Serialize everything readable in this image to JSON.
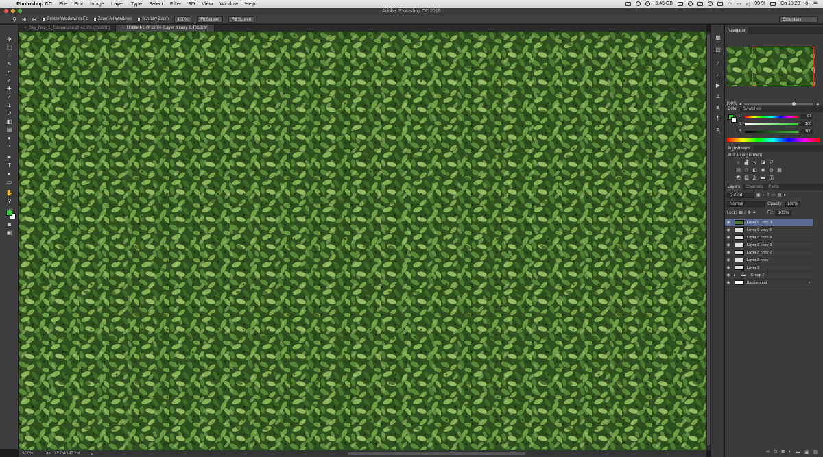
{
  "menubar": {
    "app_name": "Photoshop CC",
    "items": [
      "File",
      "Edit",
      "Image",
      "Layer",
      "Type",
      "Select",
      "Filter",
      "3D",
      "View",
      "Window",
      "Help"
    ],
    "disk_free": "6.45 GB",
    "battery": "99 %",
    "clock": "Ср 19:20"
  },
  "window": {
    "title": "Adobe Photoshop CC 2015"
  },
  "options": {
    "resize_windows": "Resize Windows to Fit",
    "zoom_all": "Zoom All Windows",
    "scrubby_zoom": "Scrubby Zoom",
    "zoom_value": "100%",
    "fit_screen": "Fit Screen",
    "fill_screen": "Fill Screen",
    "workspace": "Essentials"
  },
  "tabs": [
    {
      "label": "Sky_Rep_2_Tutorial.psd @ 42.7% (RGB/8*)"
    },
    {
      "label": "Untitled-1 @ 100% (Layer 8 copy 6, RGB/8*)"
    }
  ],
  "status": {
    "zoom": "100%",
    "doc": "Doc: 13.7M/147.2M"
  },
  "navigator": {
    "tab": "Navigator",
    "zoom": "100%"
  },
  "color": {
    "tabs": [
      "Color",
      "Swatches"
    ],
    "values": [
      "97",
      "100",
      "100"
    ],
    "fg_color": "#2ecc2e"
  },
  "adjustments": {
    "tab": "Adjustments",
    "title": "Add an adjustment"
  },
  "layers": {
    "tabs": [
      "Layers",
      "Channels",
      "Paths"
    ],
    "kind": "Kind",
    "blend": "Normal",
    "opacity_label": "Opacity:",
    "opacity": "100%",
    "lock_label": "Lock:",
    "fill_label": "Fill:",
    "fill": "100%",
    "items": [
      {
        "name": "Layer 8 copy 6",
        "selected": true
      },
      {
        "name": "Layer 8 copy 5"
      },
      {
        "name": "Layer 8 copy 4"
      },
      {
        "name": "Layer 8 copy 3"
      },
      {
        "name": "Layer 8 copy 2"
      },
      {
        "name": "Layer 8 copy"
      },
      {
        "name": "Layer 8"
      },
      {
        "name": "Group 2"
      },
      {
        "name": "Background"
      }
    ]
  }
}
